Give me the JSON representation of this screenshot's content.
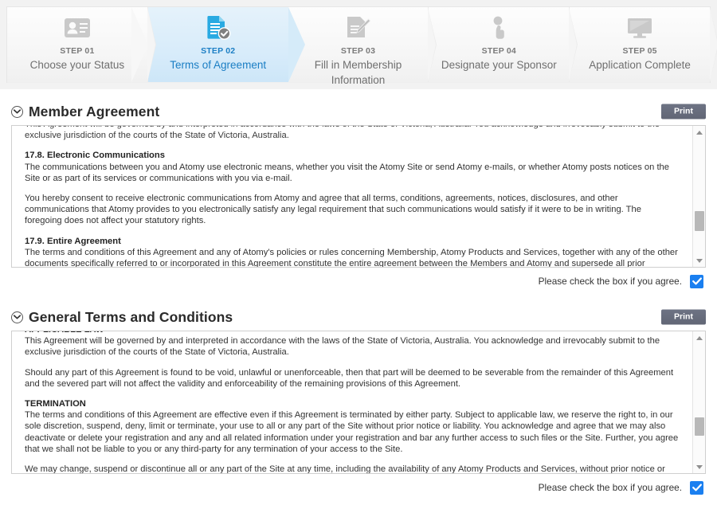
{
  "stepbar": {
    "steps": [
      {
        "num": "STEP 01",
        "label": "Choose your Status",
        "icon": "id-card-icon",
        "active": false
      },
      {
        "num": "STEP 02",
        "label": "Terms of Agreement",
        "icon": "document-check-icon",
        "active": true
      },
      {
        "num": "STEP 03",
        "label": "Fill in Membership Information",
        "icon": "form-pencil-icon",
        "active": false
      },
      {
        "num": "STEP 04",
        "label": "Designate your Sponsor",
        "icon": "person-hand-icon",
        "active": false
      },
      {
        "num": "STEP 05",
        "label": "Application Complete",
        "icon": "monitor-icon",
        "active": false
      }
    ],
    "active_color": "#1b7ec4",
    "inactive_color": "#6f6f6f"
  },
  "sections": [
    {
      "title": "Member Agreement",
      "print_label": "Print",
      "toggle_icon": "chevron-down-circle-icon",
      "agree_label": "Please check the box if you agree.",
      "checked": true,
      "scroll": {
        "thumb_top_pct": 76,
        "thumb_height_pct": 17
      },
      "paragraphs": [
        {
          "type": "clipped",
          "text": "This Agreement will be governed by and interpreted in accordance with the laws of the State of Victoria, Australia. You acknowledge and irrevocably submit to the exclusive jurisdiction of the courts of the State of Victoria, Australia."
        },
        {
          "type": "heading-inline",
          "prefix": "17.8. ",
          "heading": "Electronic Communications",
          "text": "The communications between you and Atomy use electronic means, whether you visit the Atomy Site or send Atomy e-mails, or whether Atomy posts notices on the Site or as part of its services or communications with you via e-mail."
        },
        {
          "type": "body",
          "text": "You hereby consent to receive electronic communications from Atomy and agree that all terms, conditions, agreements, notices, disclosures, and other communications that Atomy provides to you electronically satisfy any legal requirement that such communications would satisfy if it were to be in writing. The foregoing does not affect your statutory rights."
        },
        {
          "type": "heading-inline",
          "prefix": "17.9. ",
          "heading": "Entire Agreement",
          "text": "The terms and conditions of this Agreement and any of Atomy's policies or rules concerning Membership, Atomy Products and Services, together with any of the other documents specifically referred to or incorporated in this Agreement constitute the entire agreement between the Members and Atomy and supersede all prior understandings and agreements concerning its subject matter."
        }
      ]
    },
    {
      "title": "General Terms and Conditions",
      "print_label": "Print",
      "toggle_icon": "chevron-down-circle-icon",
      "agree_label": "Please check the box if you agree.",
      "checked": true,
      "scroll": {
        "thumb_top_pct": 75,
        "thumb_height_pct": 16
      },
      "paragraphs": [
        {
          "type": "clipped-heading",
          "text": "APPLICABLE LAW"
        },
        {
          "type": "body",
          "text": "This Agreement will be governed by and interpreted in accordance with the laws of the State of Victoria, Australia. You acknowledge and irrevocably submit to the exclusive jurisdiction of the courts of the State of Victoria, Australia."
        },
        {
          "type": "body",
          "text": "Should any part of this Agreement is found to be void, unlawful or unenforceable, then that part will be deemed to be severable from the remainder of this Agreement and the severed part will not affect the validity and enforceability of the remaining provisions of this Agreement."
        },
        {
          "type": "heading-block",
          "heading": "TERMINATION",
          "text": "The terms and conditions of this Agreement are effective even if this Agreement is terminated by either party. Subject to applicable law, we reserve the right to, in our sole discretion, suspend, deny, limit or terminate, your use to all or any part of the Site without prior notice or liability. You acknowledge and agree that we may also deactivate or delete your registration and any and all related information under your registration and bar any further access to such files or the Site. Further, you agree that we shall not be liable to you or any third-party for any termination of your access to the Site."
        },
        {
          "type": "body",
          "text": "We may change, suspend or discontinue all or any part of the Site at any time, including the availability of any Atomy Products and Services, without prior notice or liability."
        }
      ]
    }
  ]
}
